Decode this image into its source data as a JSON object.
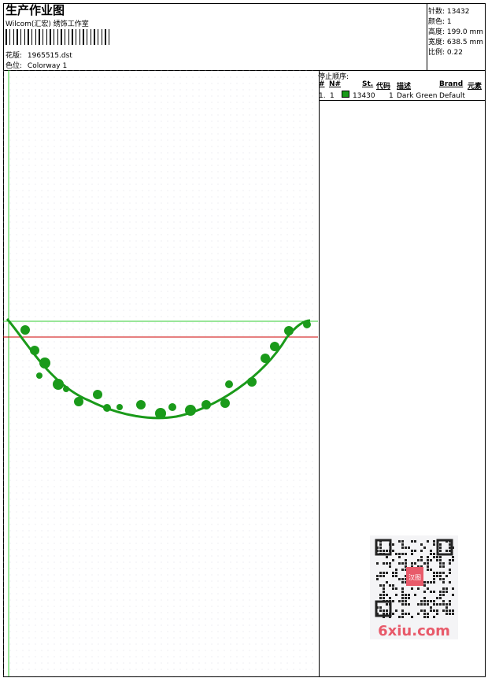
{
  "header": {
    "title": "生产作业图",
    "company": "Wilcom(汇宏) 绣饰工作室",
    "design_label": "花版:",
    "design_value": "1965515.dst",
    "colorway_label": "色位:",
    "colorway_value": "Colorway 1"
  },
  "stats": {
    "stitches": "针数: 13432",
    "colors": "颜色: 1",
    "height": "高度: 199.0 mm",
    "width": "宽度: 638.5 mm",
    "ratio": "比例: 0.22"
  },
  "stops": {
    "title": "停止顺序:",
    "headers": [
      "#",
      "N#",
      "St.",
      "代码",
      "描述",
      "Brand",
      "元素"
    ],
    "row": {
      "index": "1.",
      "needle": "1",
      "stitches": "13430",
      "code": "1",
      "description": "Dark Green",
      "brand": "Default",
      "swatch_color": "#1a9a1a"
    }
  },
  "watermark": {
    "text": "6xiu.com",
    "seal_text": "汉图"
  },
  "colors": {
    "thread": "#1a9a1a",
    "guide_green": "#33cc33",
    "guide_red": "#cc0000"
  }
}
